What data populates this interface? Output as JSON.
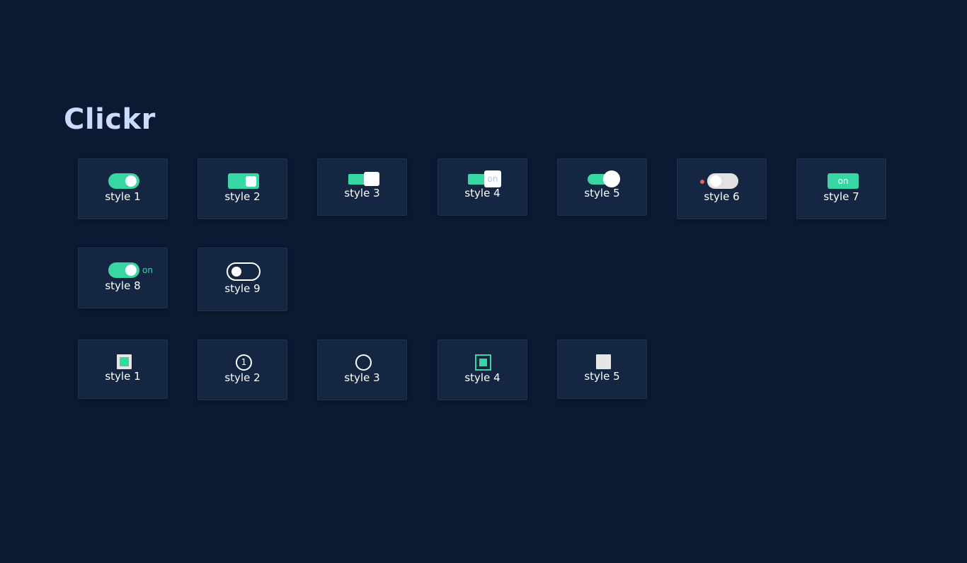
{
  "app": {
    "title": "Clickr"
  },
  "toggles": [
    {
      "label": "style 1",
      "state": "on"
    },
    {
      "label": "style 2",
      "state": "on"
    },
    {
      "label": "style 3",
      "state": "on"
    },
    {
      "label": "style 4",
      "state": "on",
      "knob_text": "on"
    },
    {
      "label": "style 5",
      "state": "on"
    },
    {
      "label": "style 6",
      "state": "off"
    },
    {
      "label": "style 7",
      "state": "on",
      "text": "on"
    },
    {
      "label": "style 8",
      "state": "on",
      "text": "on"
    },
    {
      "label": "style 9",
      "state": "off"
    }
  ],
  "checkboxes": [
    {
      "label": "style 1",
      "state": "checked"
    },
    {
      "label": "style 2",
      "state": "checked",
      "text": "1"
    },
    {
      "label": "style 3",
      "state": "unchecked"
    },
    {
      "label": "style 4",
      "state": "checked"
    },
    {
      "label": "style 5",
      "state": "unchecked"
    }
  ],
  "colors": {
    "background": "#0b1932",
    "card": "#152643",
    "accent": "#37d6a3",
    "title": "#c9dcfb",
    "indicator_red": "#f05a5a"
  }
}
